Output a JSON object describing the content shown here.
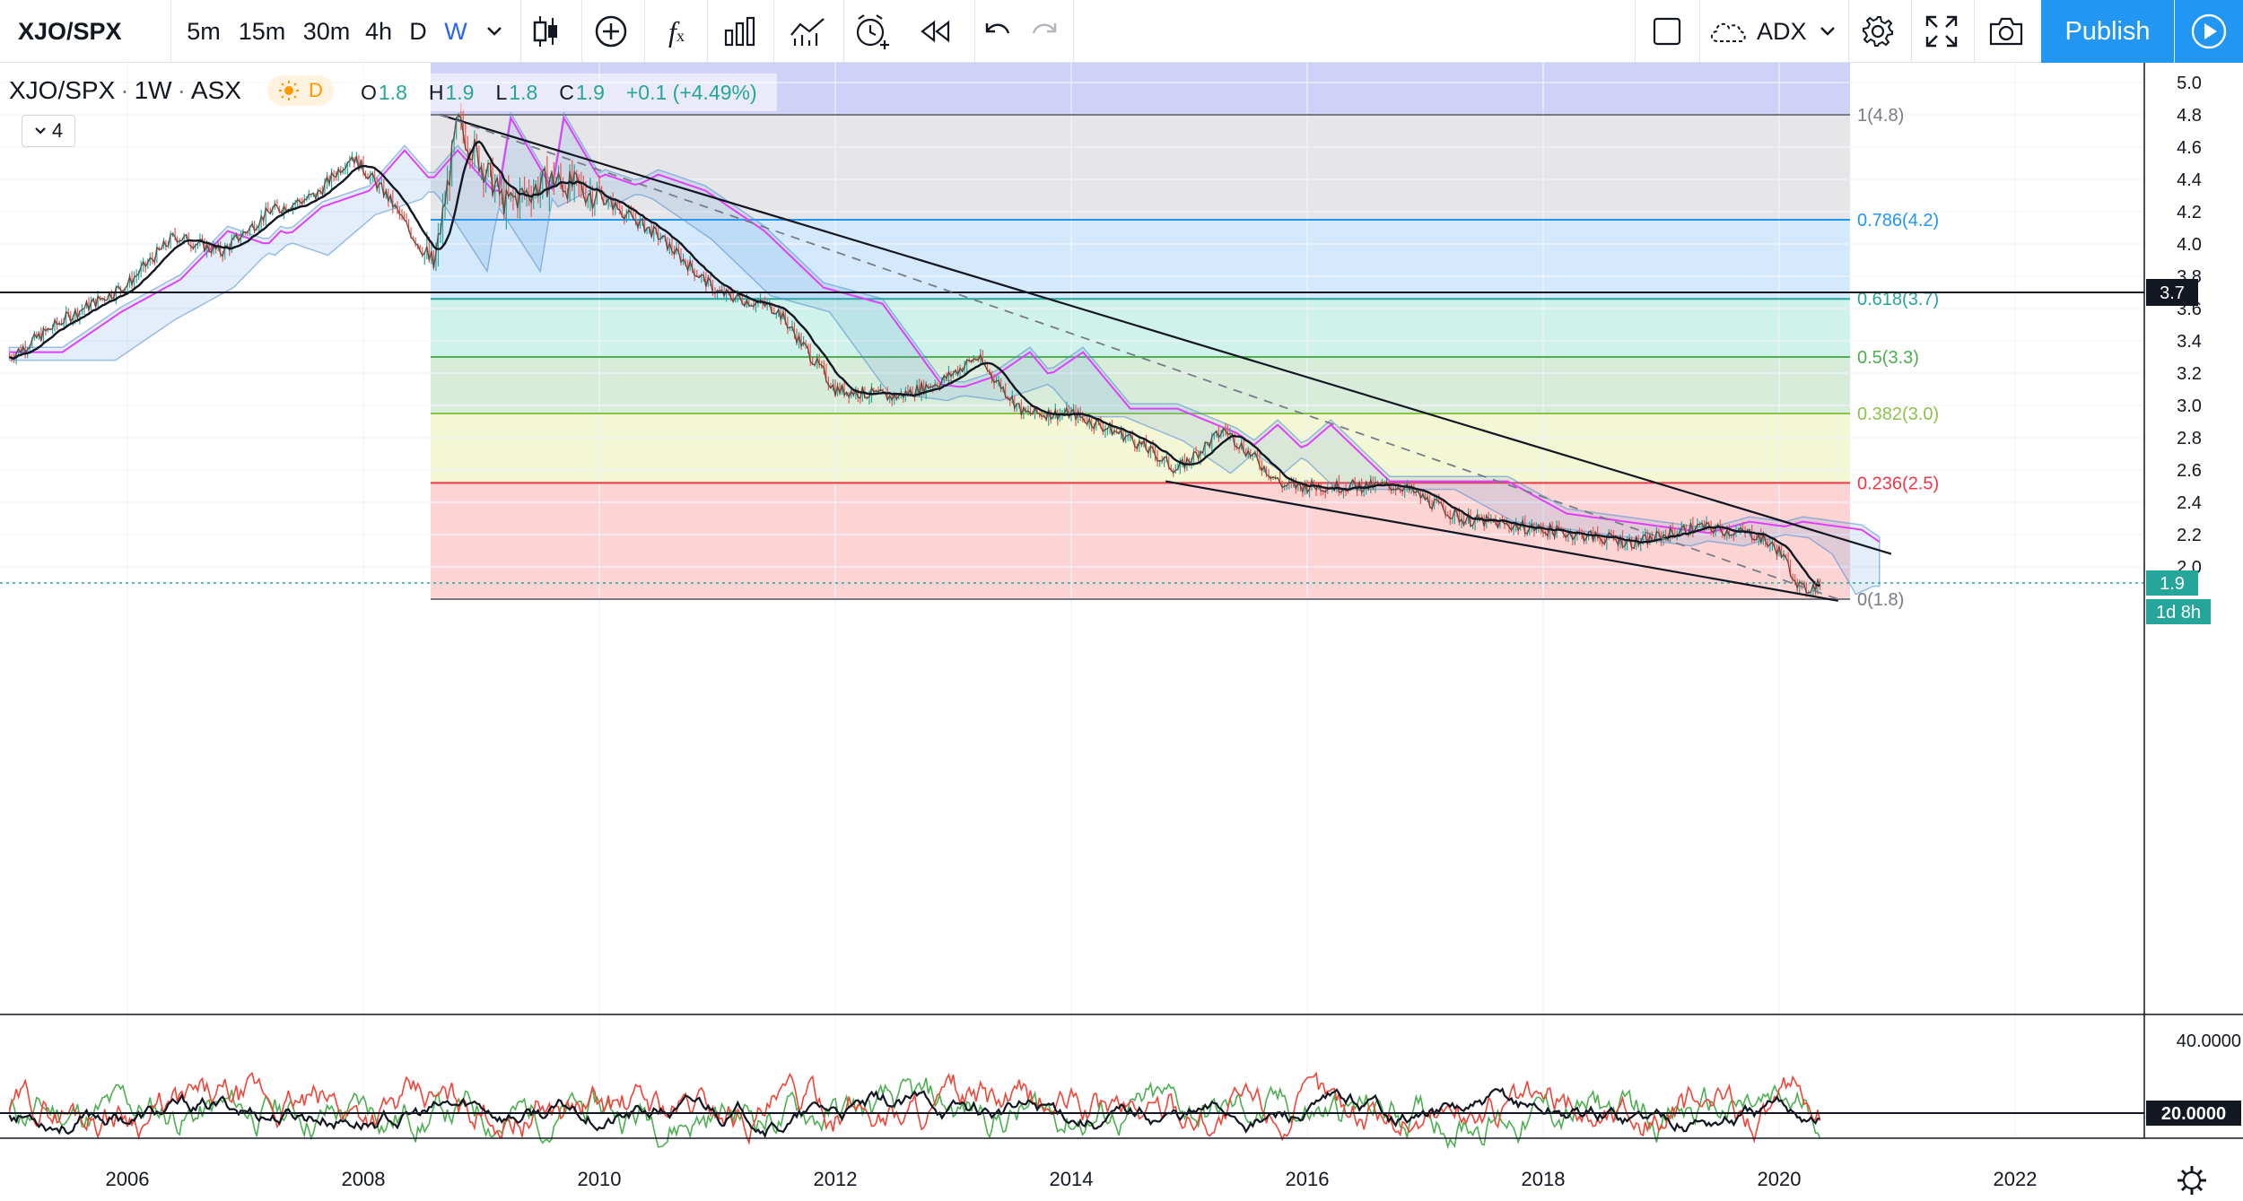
{
  "toolbar": {
    "symbol": "XJO/SPX",
    "timeframes": [
      "5m",
      "15m",
      "30m",
      "4h",
      "D",
      "W"
    ],
    "active_timeframe": "W",
    "indicator_label": "ADX",
    "publish_label": "Publish"
  },
  "legend": {
    "title": "XJO/SPX",
    "interval": "1W",
    "exchange": "ASX",
    "session_badge": "D",
    "open_key": "O",
    "open_value": "1.8",
    "high_key": "H",
    "high_value": "1.9",
    "low_key": "L",
    "low_value": "1.8",
    "close_key": "C",
    "close_value": "1.9",
    "change": "+0.1 (+4.49%)",
    "collapsed_count": "4"
  },
  "chart_data": {
    "type": "line",
    "series_name": "XJO/SPX",
    "x_ticks": [
      "2006",
      "2008",
      "2010",
      "2012",
      "2014",
      "2016",
      "2018",
      "2020",
      "2022"
    ],
    "y_ticks": [
      "5.0",
      "4.8",
      "4.6",
      "4.4",
      "4.2",
      "4.0",
      "3.8",
      "3.6",
      "3.4",
      "3.2",
      "3.0",
      "2.8",
      "2.6",
      "2.4",
      "2.2",
      "2.0"
    ],
    "ylim": [
      1.6,
      5.1
    ],
    "price_points": [
      [
        2005.0,
        3.3
      ],
      [
        2005.5,
        3.55
      ],
      [
        2006.0,
        3.75
      ],
      [
        2006.4,
        4.05
      ],
      [
        2006.8,
        3.95
      ],
      [
        2007.2,
        4.2
      ],
      [
        2007.6,
        4.3
      ],
      [
        2007.9,
        4.55
      ],
      [
        2008.2,
        4.3
      ],
      [
        2008.6,
        3.85
      ],
      [
        2008.8,
        4.75
      ],
      [
        2009.2,
        4.25
      ],
      [
        2009.6,
        4.4
      ],
      [
        2010.0,
        4.3
      ],
      [
        2010.5,
        4.05
      ],
      [
        2011.0,
        3.7
      ],
      [
        2011.5,
        3.6
      ],
      [
        2012.0,
        3.1
      ],
      [
        2012.5,
        3.05
      ],
      [
        2012.9,
        3.15
      ],
      [
        2013.2,
        3.3
      ],
      [
        2013.6,
        2.95
      ],
      [
        2014.0,
        2.95
      ],
      [
        2014.5,
        2.8
      ],
      [
        2014.9,
        2.6
      ],
      [
        2015.3,
        2.85
      ],
      [
        2015.8,
        2.5
      ],
      [
        2016.3,
        2.5
      ],
      [
        2016.8,
        2.5
      ],
      [
        2017.3,
        2.3
      ],
      [
        2017.8,
        2.25
      ],
      [
        2018.3,
        2.2
      ],
      [
        2018.8,
        2.15
      ],
      [
        2019.3,
        2.25
      ],
      [
        2019.8,
        2.2
      ],
      [
        2020.0,
        2.1
      ],
      [
        2020.2,
        1.85
      ],
      [
        2020.35,
        1.9
      ]
    ],
    "last_price_label": "1.9",
    "countdown_label": "1d 8h",
    "horizontal_line_label": "3.7",
    "fib_levels": [
      {
        "label": "1(4.8)",
        "value": 4.8,
        "color": "#787b86"
      },
      {
        "label": "0.786(4.2)",
        "value": 4.15,
        "color": "#2196f3"
      },
      {
        "label": "0.618(3.7)",
        "value": 3.66,
        "color": "#26a69a"
      },
      {
        "label": "0.5(3.3)",
        "value": 3.3,
        "color": "#4caf50"
      },
      {
        "label": "0.382(3.0)",
        "value": 2.95,
        "color": "#8bc34a"
      },
      {
        "label": "0.236(2.5)",
        "value": 2.52,
        "color": "#f23645"
      },
      {
        "label": "0(1.8)",
        "value": 1.8,
        "color": "#787b86"
      }
    ],
    "indicator": {
      "name": "ADX",
      "y_ticks": [
        "40.0000",
        "20.0000"
      ]
    }
  }
}
